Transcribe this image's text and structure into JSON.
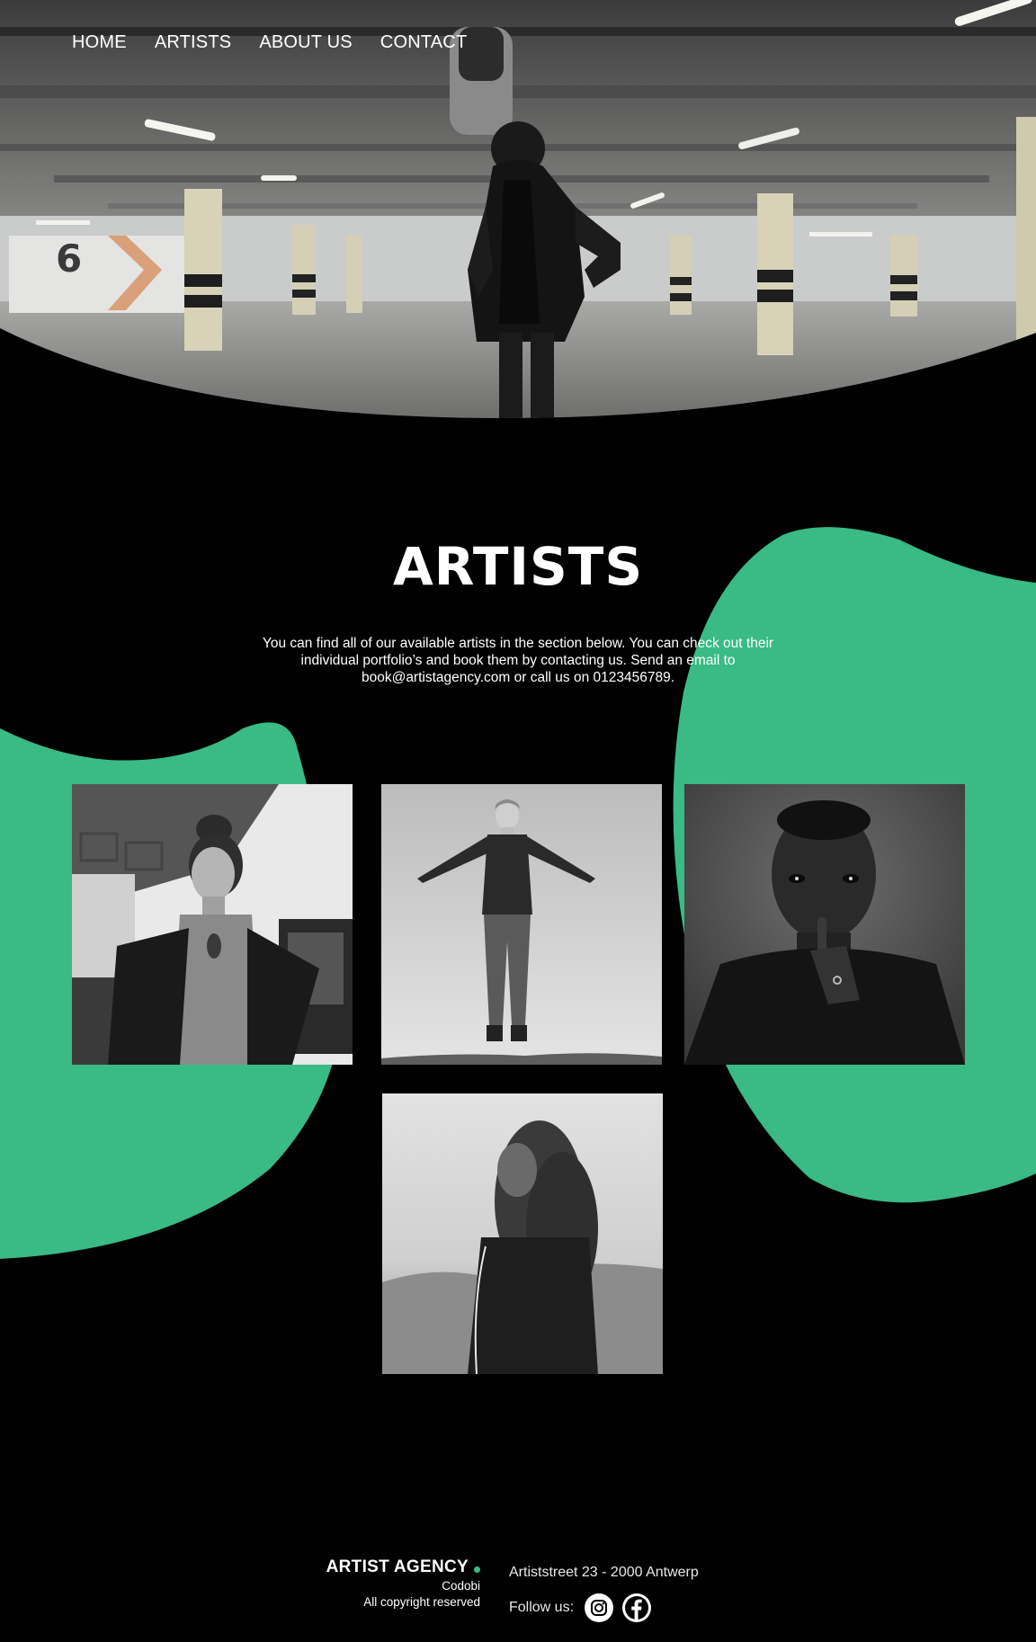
{
  "nav": {
    "items": [
      {
        "label": "HOME"
      },
      {
        "label": "ARTISTS"
      },
      {
        "label": "ABOUT US"
      },
      {
        "label": "CONTACT"
      }
    ]
  },
  "hero": {
    "image": "parking-garage-hooded-person-photo",
    "level_sign": "6"
  },
  "artists": {
    "title": "ARTISTS",
    "description": "You can find all of our available artists in the section below. You can check out their individual portfolio’s and book them by contacting us. Send an email to book@artistagency.com or call us on 0123456789.",
    "cards": [
      {
        "image": "woman-portrait-bw"
      },
      {
        "image": "levitating-man-bw"
      },
      {
        "image": "man-finger-on-lips-bw"
      },
      {
        "image": "curly-haired-woman-bw"
      }
    ]
  },
  "footer": {
    "brand": "ARTIST AGENCY",
    "company": "Codobi",
    "copyright": "All copyright reserved",
    "address": "Artiststreet 23 - 2000 Antwerp",
    "follow_label": "Follow us:",
    "social": [
      "instagram-icon",
      "facebook-icon"
    ]
  },
  "colors": {
    "accent": "#3aba85",
    "background": "#000000",
    "text": "#ffffff"
  }
}
